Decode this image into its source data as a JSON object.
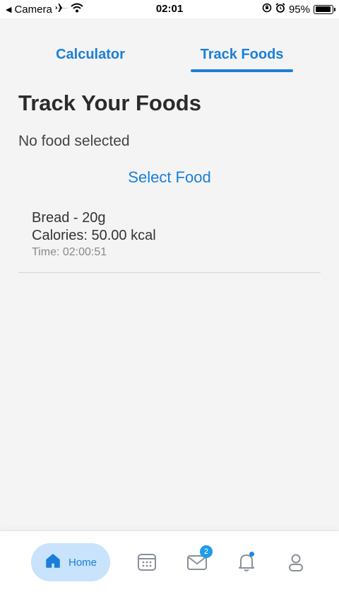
{
  "status_bar": {
    "back_arrow": "◀",
    "carrier": "Camera",
    "time": "02:01",
    "battery_percent_label": "95%",
    "battery_level": 0.95,
    "icons": [
      "airplane-icon",
      "wifi-icon",
      "orientation-lock-icon",
      "alarm-icon",
      "battery-icon"
    ]
  },
  "tabs": {
    "items": [
      {
        "label": "Calculator",
        "active": false
      },
      {
        "label": "Track Foods",
        "active": true
      }
    ]
  },
  "main": {
    "title": "Track Your Foods",
    "selection_status": "No food selected",
    "select_button_label": "Select Food",
    "entries": [
      {
        "name": "Bread - 20g",
        "calories": "Calories: 50.00 kcal",
        "time": "Time: 02:00:51"
      }
    ]
  },
  "bottom_nav": {
    "items": [
      {
        "icon": "home-icon",
        "label": "Home",
        "active": true
      },
      {
        "icon": "calendar-icon",
        "label": ""
      },
      {
        "icon": "mail-icon",
        "badge": "2"
      },
      {
        "icon": "bell-icon",
        "has_dot": true
      },
      {
        "icon": "user-icon"
      }
    ]
  },
  "colors": {
    "accent": "#1a7fd8",
    "active_pill": "#c8e3fb",
    "badge": "#1e9be9",
    "background": "#f4f4f5"
  }
}
